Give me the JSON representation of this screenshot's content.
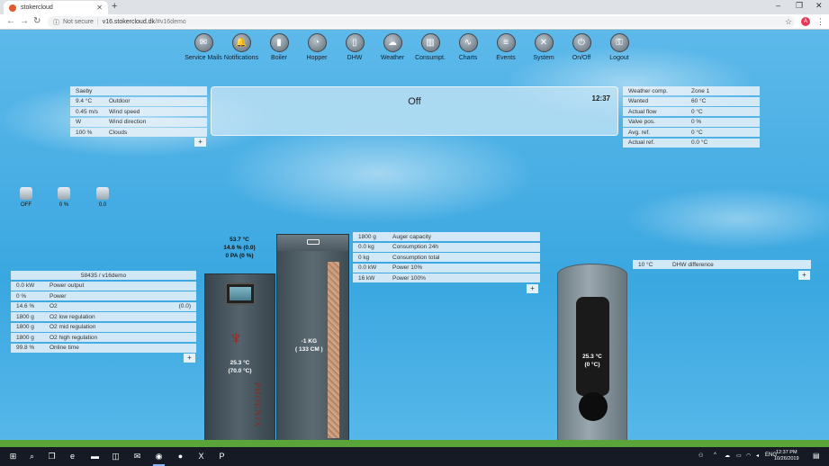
{
  "browser": {
    "tab_title": "stokercloud",
    "security": "Not secure",
    "url_domain": "v16.stokercloud.dk",
    "url_path": "/#v16demo",
    "profile_initial": "A"
  },
  "nav": [
    {
      "label": "Service Mails",
      "icon": "envelope-icon",
      "glyph": "✉"
    },
    {
      "label": "Notifications",
      "icon": "bell-icon",
      "glyph": "🔔"
    },
    {
      "label": "Boiler",
      "icon": "boiler-icon",
      "glyph": "▮"
    },
    {
      "label": "Hopper",
      "icon": "hopper-gauge-icon",
      "glyph": "◔"
    },
    {
      "label": "DHW",
      "icon": "water-tank-icon",
      "glyph": "▯"
    },
    {
      "label": "Weather",
      "icon": "cloud-icon",
      "glyph": "☁"
    },
    {
      "label": "Consumpt.",
      "icon": "bar-chart-icon",
      "glyph": "▥"
    },
    {
      "label": "Charts",
      "icon": "line-chart-icon",
      "glyph": "∿"
    },
    {
      "label": "Events",
      "icon": "list-icon",
      "glyph": "≡"
    },
    {
      "label": "System",
      "icon": "tools-icon",
      "glyph": "✕"
    },
    {
      "label": "On/Off",
      "icon": "power-icon",
      "glyph": "⏻"
    },
    {
      "label": "Logout",
      "icon": "key-icon",
      "glyph": "⚿"
    }
  ],
  "weather": {
    "location": "Saeby",
    "rows": [
      {
        "value": "9.4 °C",
        "label": "Outdoor"
      },
      {
        "value": "0.45 m/s",
        "label": "Wind speed"
      },
      {
        "value": "W",
        "label": "Wind direction"
      },
      {
        "value": "100 %",
        "label": "Clouds"
      }
    ]
  },
  "status": {
    "state": "Off",
    "time": "12:37"
  },
  "weather_comp": {
    "rows": [
      {
        "value": "Weather comp.",
        "label": "Zone 1"
      },
      {
        "value": "Wanted",
        "label": "60 °C"
      },
      {
        "value": "Actual flow",
        "label": "0 °C"
      },
      {
        "value": "Valve pos.",
        "label": "0 %"
      },
      {
        "value": "Avg. ref.",
        "label": "0 °C"
      },
      {
        "value": "Actual ref.",
        "label": "0.0 °C"
      }
    ]
  },
  "sensors": [
    {
      "label": "OFF",
      "icon": "thermometer-icon"
    },
    {
      "label": "0 %",
      "icon": "fan-icon"
    },
    {
      "label": "0.0",
      "icon": "flame-sensor-icon"
    }
  ],
  "boiler": {
    "header": "58435 / v16demo",
    "rows": [
      {
        "value": "0.0 kW",
        "label": "Power output",
        "extra": ""
      },
      {
        "value": "0 %",
        "label": "Power",
        "extra": ""
      },
      {
        "value": "14.6 %",
        "label": "O2",
        "extra": "(0.0)"
      },
      {
        "value": "1800 g",
        "label": "O2 low regulation",
        "extra": ""
      },
      {
        "value": "1800 g",
        "label": "O2 mid regulation",
        "extra": ""
      },
      {
        "value": "1800 g",
        "label": "O2 high regulation",
        "extra": ""
      },
      {
        "value": "99.8 %",
        "label": "Online time",
        "extra": ""
      }
    ],
    "status_line1": "53.7 °C",
    "status_line2": "14.6 % (0.0)",
    "status_line3": "0 PA (0 %)",
    "temp_line1": "25.3 °C",
    "temp_line2": "(70.0 °C)",
    "brand": "PHOENIX"
  },
  "hopper": {
    "rows": [
      {
        "value": "1800 g",
        "label": "Auger capacity"
      },
      {
        "value": "0.0 kg",
        "label": "Consumption 24h"
      },
      {
        "value": "0 kg",
        "label": "Consumption total"
      },
      {
        "value": "0.0 kW",
        "label": "Power 10%"
      },
      {
        "value": "16 kW",
        "label": "Power 100%"
      }
    ],
    "level_line1": "-1 KG",
    "level_line2": "( 133 CM )"
  },
  "dhw": {
    "rows": [
      {
        "value": "10 °C",
        "label": "DHW difference"
      }
    ],
    "temp_line1": "25.3 °C",
    "temp_line2": "(0 °C)"
  },
  "plus_label": "+",
  "taskbar": {
    "lang": "ENG",
    "time": "12:37 PM",
    "date": "10/26/2019"
  }
}
